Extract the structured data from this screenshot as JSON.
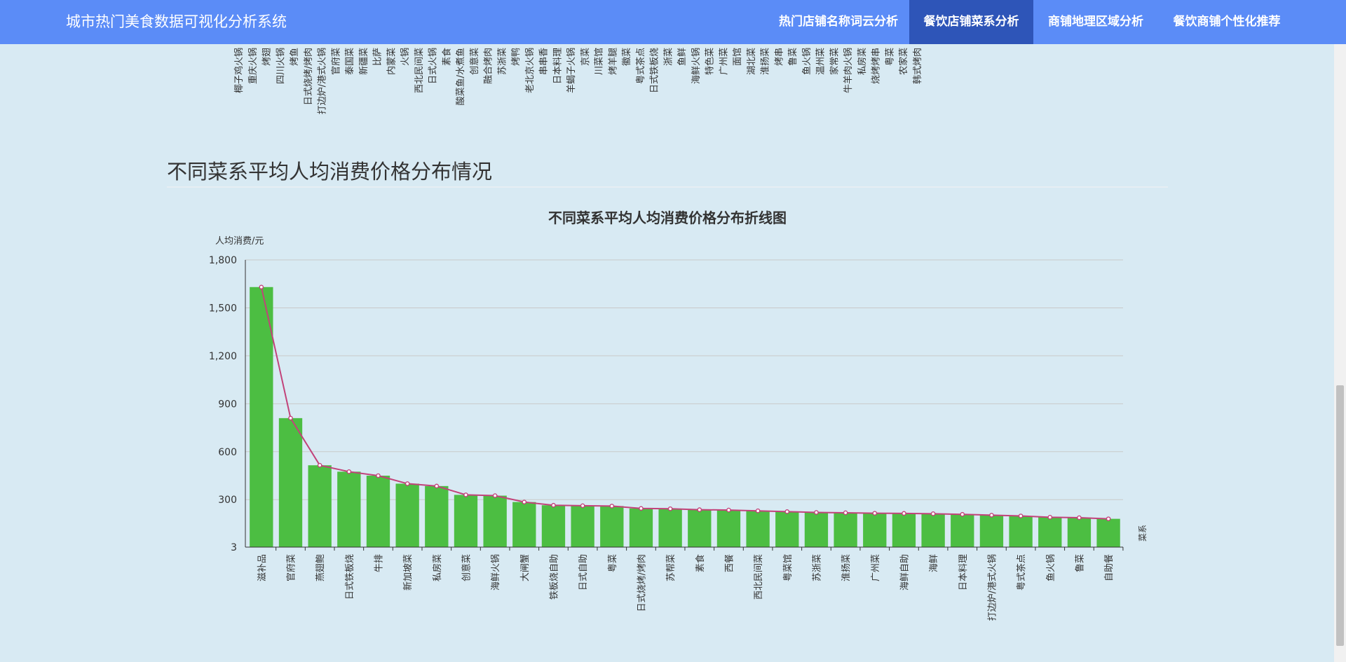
{
  "navbar": {
    "brand": "城市热门美食数据可视化分析系统",
    "items": [
      {
        "label": "热门店铺名称词云分析",
        "active": false
      },
      {
        "label": "餐饮店铺菜系分析",
        "active": true
      },
      {
        "label": "商铺地理区域分析",
        "active": false
      },
      {
        "label": "餐饮商铺个性化推荐",
        "active": false
      }
    ]
  },
  "top_chart_labels": [
    "椰子鸡火锅",
    "重庆火锅",
    "烤翅",
    "四川火锅",
    "烤鱼",
    "日式烧烤/烤肉",
    "打边炉/港式火锅",
    "官府菜",
    "泰国菜",
    "新疆菜",
    "比萨",
    "内蒙菜",
    "火锅",
    "西北民间菜",
    "日式火锅",
    "素食",
    "酸菜鱼/水煮鱼",
    "创意菜",
    "融合烤肉",
    "苏浙菜",
    "烤鸭",
    "老北京火锅",
    "串串香",
    "日本料理",
    "羊蝎子火锅",
    "京菜",
    "川菜馆",
    "烤羊腿",
    "徽菜",
    "粤式茶点",
    "日式铁板烧",
    "浙菜",
    "鱼鲜",
    "海鲜火锅",
    "特色菜",
    "广州菜",
    "面馆",
    "湖北菜",
    "淮扬菜",
    "烤串",
    "鲁菜",
    "鱼火锅",
    "温州菜",
    "家常菜",
    "牛羊肉火锅",
    "私房菜",
    "烧烤烤串",
    "粤菜",
    "农家菜",
    "韩式烤肉"
  ],
  "section": {
    "title": "不同菜系平均人均消费价格分布情况"
  },
  "chart_data": {
    "type": "bar",
    "title": "不同菜系平均人均消费价格分布折线图",
    "ylabel": "人均消费/元",
    "xlabel": "菜系",
    "yticks": [
      "1,800",
      "1,500",
      "1,200",
      "900",
      "600",
      "300",
      "3"
    ],
    "ylim": [
      3,
      1800
    ],
    "grid": true,
    "bar_color": "#4cbe42",
    "line_color": "#c2437a",
    "categories": [
      "滋补品",
      "官府菜",
      "燕翅鲍",
      "日式铁板烧",
      "牛排",
      "新加坡菜",
      "私房菜",
      "创意菜",
      "海鲜火锅",
      "大闸蟹",
      "铁板烧自助",
      "日式自助",
      "粤菜",
      "日式烧烤/烤肉",
      "苏帮菜",
      "素食",
      "西餐",
      "西北民间菜",
      "粤菜馆",
      "苏浙菜",
      "淮扬菜",
      "广州菜",
      "海鲜自助",
      "海鲜",
      "日本料理",
      "打边炉/港式火锅",
      "粤式茶点",
      "鱼火锅",
      "鲁菜",
      "自助餐"
    ],
    "values": [
      1630,
      810,
      515,
      475,
      450,
      400,
      385,
      330,
      325,
      285,
      265,
      262,
      260,
      245,
      243,
      237,
      235,
      230,
      225,
      220,
      218,
      215,
      214,
      212,
      208,
      203,
      198,
      190,
      187,
      180
    ]
  }
}
